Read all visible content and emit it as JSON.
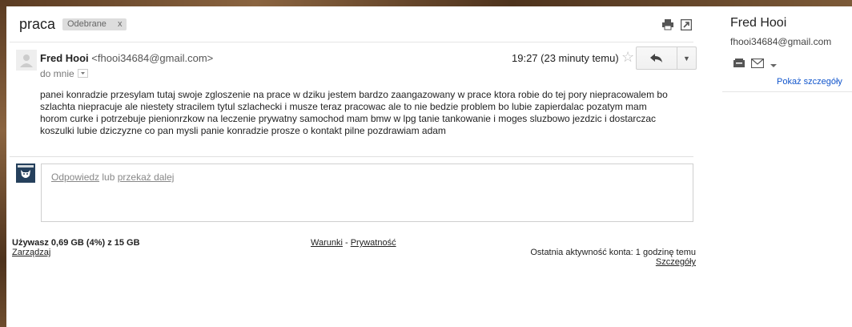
{
  "thread": {
    "subject": "praca",
    "label": "Odebrane",
    "label_remove": "x"
  },
  "message": {
    "sender_name": "Fred Hooi",
    "sender_email": "<fhooi34684@gmail.com>",
    "to": "do mnie",
    "time": "19:27 (23 minuty temu)",
    "body": "panei konradzie przesylam tutaj swoje zgloszenie na prace w dziku jestem bardzo zaangazowany w prace ktora robie do tej pory niepracowalem bo szlachta niepracuje ale niestety stracilem tytul szlachecki i musze teraz pracowac ale to nie bedzie problem bo lubie zapierdalac pozatym mam horom curke i potrzebuje pienionrzkow na leczenie prywatny samochod mam bmw w lpg tanie tankowanie i moges sluzbowo jezdzic i dostarczac koszulki lubie dziczyzne co pan mysli panie konradzie prosze o kontakt pilne pozdrawiam adam"
  },
  "reply_box": {
    "reply_link": "Odpowiedz",
    "or_text": " lub ",
    "forward_link": "przekaż dalej"
  },
  "footer": {
    "storage": "Używasz 0,69 GB (4%) z 15 GB",
    "manage": "Zarządzaj",
    "terms": "Warunki",
    "dash": " - ",
    "privacy": "Prywatność",
    "activity": "Ostatnia aktywność konta: 1 godzinę temu",
    "details": "Szczegóły"
  },
  "contact_panel": {
    "name": "Fred Hooi",
    "email": "fhooi34684@gmail.com",
    "show_details": "Pokaż szczegóły"
  },
  "colors": {
    "link_blue": "#1155cc",
    "label_bg": "#dddddd",
    "avatar_navy": "#25405c"
  }
}
